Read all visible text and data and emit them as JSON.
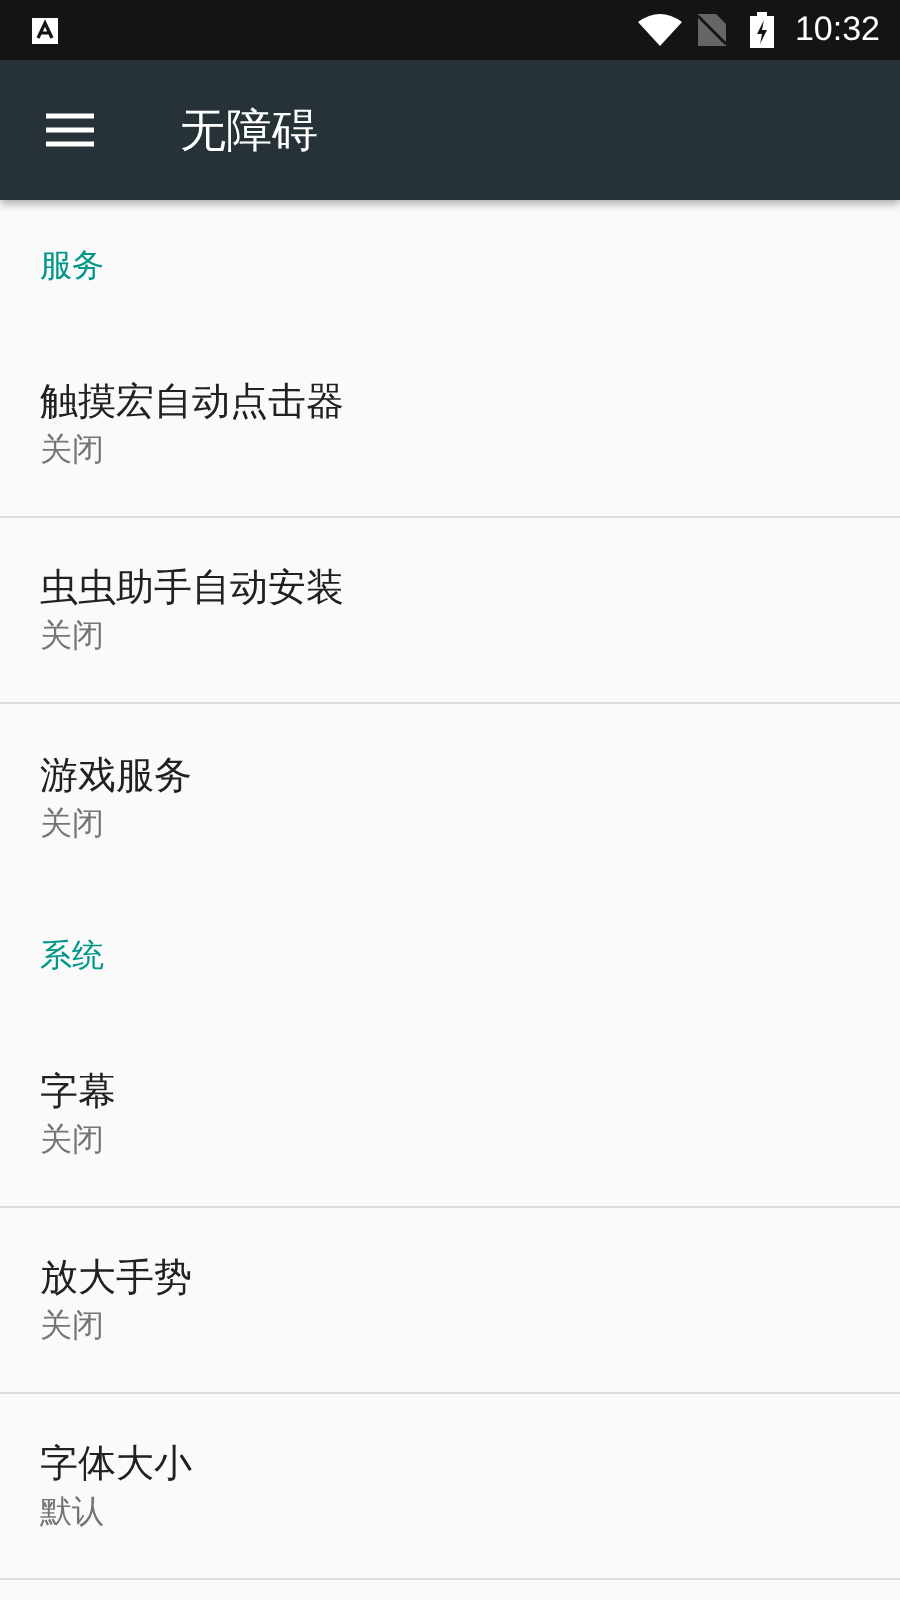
{
  "status_bar": {
    "time": "10:32"
  },
  "app_bar": {
    "title": "无障碍"
  },
  "sections": [
    {
      "title": "服务",
      "items": [
        {
          "title": "触摸宏自动点击器",
          "summary": "关闭"
        },
        {
          "title": "虫虫助手自动安装",
          "summary": "关闭"
        },
        {
          "title": "游戏服务",
          "summary": "关闭"
        }
      ]
    },
    {
      "title": "系统",
      "items": [
        {
          "title": "字幕",
          "summary": "关闭"
        },
        {
          "title": "放大手势",
          "summary": "关闭"
        },
        {
          "title": "字体大小",
          "summary": "默认"
        }
      ]
    }
  ]
}
